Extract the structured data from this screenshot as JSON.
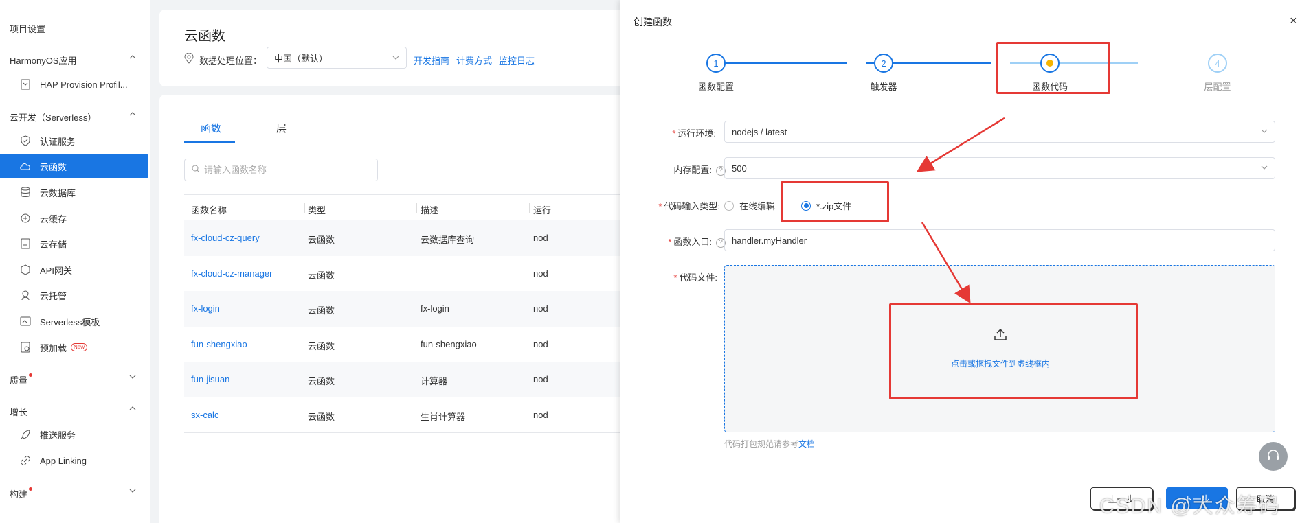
{
  "sidebar": {
    "project_settings": "项目设置",
    "harmony_group": "HarmonyOS应用",
    "hap_item": "HAP Provision Profil...",
    "serverless_group": "云开发（Serverless）",
    "items": [
      {
        "label": "认证服务",
        "icon": "shield-icon"
      },
      {
        "label": "云函数",
        "icon": "cloud-function-icon"
      },
      {
        "label": "云数据库",
        "icon": "database-icon"
      },
      {
        "label": "云缓存",
        "icon": "cache-icon"
      },
      {
        "label": "云存储",
        "icon": "storage-icon"
      },
      {
        "label": "API网关",
        "icon": "api-gateway-icon"
      },
      {
        "label": "云托管",
        "icon": "hosting-icon"
      },
      {
        "label": "Serverless模板",
        "icon": "template-icon"
      },
      {
        "label": "预加载",
        "icon": "preload-icon"
      }
    ],
    "new_badge": "New",
    "quality_group": "质量",
    "growth_group": "增长",
    "push_item": "推送服务",
    "applinking_item": "App Linking",
    "build_group": "构建"
  },
  "header": {
    "title": "云函数",
    "location_label": "数据处理位置：",
    "location_value": "中国（默认）",
    "links": [
      "开发指南",
      "计费方式",
      "监控日志"
    ]
  },
  "tabs": [
    "函数",
    "层"
  ],
  "search": {
    "placeholder": "请输入函数名称"
  },
  "table": {
    "headers": [
      "函数名称",
      "类型",
      "描述",
      "运行"
    ],
    "rows": [
      {
        "name": "fx-cloud-cz-query",
        "type": "云函数",
        "desc": "云数据库查询",
        "runtime": "nod"
      },
      {
        "name": "fx-cloud-cz-manager",
        "type": "云函数",
        "desc": "",
        "runtime": "nod"
      },
      {
        "name": "fx-login",
        "type": "云函数",
        "desc": "fx-login",
        "runtime": "nod"
      },
      {
        "name": "fun-shengxiao",
        "type": "云函数",
        "desc": "fun-shengxiao",
        "runtime": "nod"
      },
      {
        "name": "fun-jisuan",
        "type": "云函数",
        "desc": "计算器",
        "runtime": "nod"
      },
      {
        "name": "sx-calc",
        "type": "云函数",
        "desc": "生肖计算器",
        "runtime": "nod"
      }
    ]
  },
  "drawer": {
    "title": "创建函数",
    "close": "×",
    "steps": [
      {
        "num": "1",
        "label": "函数配置",
        "state": "done"
      },
      {
        "num": "2",
        "label": "触发器",
        "state": "done"
      },
      {
        "num": "",
        "label": "函数代码",
        "state": "current"
      },
      {
        "num": "4",
        "label": "层配置",
        "state": "pending"
      }
    ],
    "runtime_label": "运行环境:",
    "runtime_value": "nodejs / latest",
    "memory_label": "内存配置:",
    "memory_value": "500",
    "code_type_label": "代码输入类型:",
    "code_type_options": [
      "在线编辑",
      "*.zip文件"
    ],
    "code_type_selected": 1,
    "entry_label": "函数入口:",
    "entry_value": "handler.myHandler",
    "file_label": "代码文件:",
    "upload_text": "点击或拖拽文件到虚线框内",
    "hint_prefix": "代码打包规范请参考",
    "hint_link": "文档",
    "btn_prev": "上一步",
    "btn_next": "下一步",
    "btn_cancel": "取消"
  },
  "watermark": "CSDN @大众筹码",
  "colors": {
    "accent": "#1976e3",
    "annotation": "#e53935",
    "current_step": "#f5b400"
  }
}
